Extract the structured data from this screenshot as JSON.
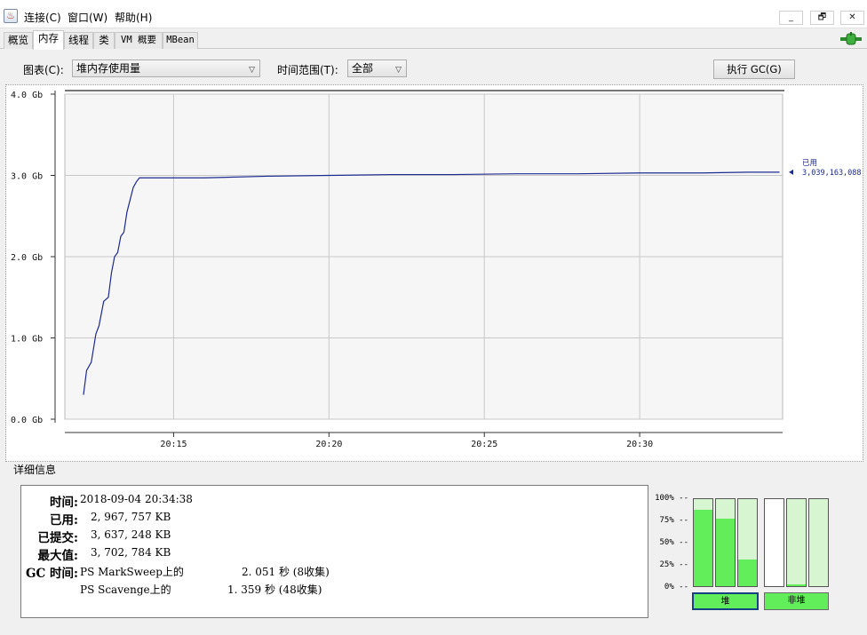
{
  "menubar": {
    "items": [
      "连接(C)",
      "窗口(W)",
      "帮助(H)"
    ]
  },
  "window_controls": {
    "minimize": "_",
    "restore": "🗗",
    "close": "✕"
  },
  "tabs": [
    "概览",
    "内存",
    "线程",
    "类",
    "VM 概要",
    "MBean"
  ],
  "active_tab": "内存",
  "toolbar": {
    "chart_label": "图表(C):",
    "chart_value": "堆内存使用量",
    "range_label": "时间范围(T):",
    "range_value": "全部",
    "gc_button": "执行 GC(G)"
  },
  "colors": {
    "line": "#1d2a8f",
    "used_green": "#62ee5b",
    "committed_green": "#d7f5d0",
    "selected_border": "#14417f"
  },
  "chart_data": {
    "type": "line",
    "y_ticks": [
      "4.0 Gb",
      "3.0 Gb",
      "2.0 Gb",
      "1.0 Gb",
      "0.0 Gb"
    ],
    "x_ticks": [
      "20:15",
      "20:20",
      "20:25",
      "20:30"
    ],
    "ylim": [
      0,
      4.0
    ],
    "y_unit": "Gb",
    "x_minutes": [
      12.1,
      12.2,
      12.35,
      12.5,
      12.6,
      12.75,
      12.9,
      13.0,
      13.1,
      13.2,
      13.3,
      13.4,
      13.5,
      13.6,
      13.7,
      13.8,
      13.9,
      14.0,
      16.0,
      18.0,
      20.0,
      22.0,
      24.0,
      26.0,
      28.0,
      30.0,
      32.0,
      33.5,
      34.5
    ],
    "y_values": [
      0.3,
      0.6,
      0.7,
      1.05,
      1.15,
      1.45,
      1.5,
      1.8,
      2.0,
      2.05,
      2.25,
      2.3,
      2.55,
      2.7,
      2.85,
      2.92,
      2.97,
      2.97,
      2.97,
      2.99,
      3.0,
      3.01,
      3.01,
      3.02,
      3.02,
      3.03,
      3.03,
      3.04,
      3.04
    ],
    "x_ticks_minutes": [
      15,
      20,
      25,
      30
    ],
    "legend": {
      "name": "已用",
      "value": "3,039,163,088"
    },
    "grid": true
  },
  "details": {
    "title": "详细信息",
    "time_label": "时间:",
    "time_value": "2018-09-04 20:34:38",
    "used_label": "已用:",
    "used_value": "2, 967, 757 KB",
    "committed_label": "已提交:",
    "committed_value": "3, 637, 248 KB",
    "max_label": "最大值:",
    "max_value": "3, 702, 784 KB",
    "gc_label": "GC 时间:",
    "gc_rows": [
      {
        "name": "PS MarkSweep上的",
        "value": "2. 051 秒 (8收集)"
      },
      {
        "name": "PS Scavenge上的",
        "value": "1. 359 秒 (48收集)"
      }
    ]
  },
  "pools": {
    "pct_labels": [
      "100% --",
      "75% --",
      "50% --",
      "25% --",
      "0% --"
    ],
    "heap_label": "堆",
    "nonheap_label": "非堆",
    "bars": [
      {
        "used": 0.88,
        "committed": 1.0
      },
      {
        "used": 0.78,
        "committed": 1.0
      },
      {
        "used": 0.31,
        "committed": 1.0
      },
      {
        "used": 0.0,
        "committed": 0.0
      },
      {
        "used": 0.02,
        "committed": 1.0
      },
      {
        "used": 0.0,
        "committed": 1.0
      }
    ]
  }
}
